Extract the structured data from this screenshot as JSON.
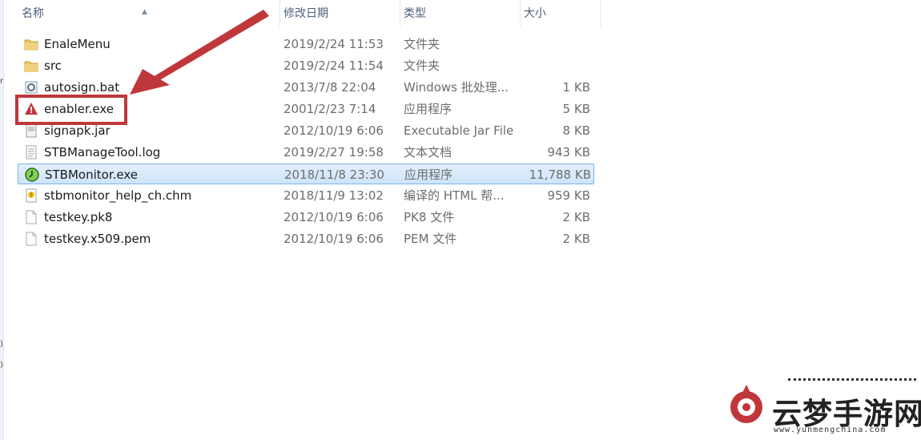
{
  "columns": {
    "name": "名称",
    "date": "修改日期",
    "type": "类型",
    "size": "大小"
  },
  "files": [
    {
      "name": "EnaleMenu",
      "date": "2019/2/24 11:53",
      "type": "文件夹",
      "size": "",
      "icon": "folder-icon"
    },
    {
      "name": "src",
      "date": "2019/2/24 11:54",
      "type": "文件夹",
      "size": "",
      "icon": "folder-icon"
    },
    {
      "name": "autosign.bat",
      "date": "2013/7/8 22:04",
      "type": "Windows 批处理...",
      "size": "1 KB",
      "icon": "batch-file-icon"
    },
    {
      "name": "enabler.exe",
      "date": "2001/2/23 7:14",
      "type": "应用程序",
      "size": "5 KB",
      "icon": "warning-exe-icon"
    },
    {
      "name": "signapk.jar",
      "date": "2012/10/19 6:06",
      "type": "Executable Jar File",
      "size": "8 KB",
      "icon": "jar-file-icon"
    },
    {
      "name": "STBManageTool.log",
      "date": "2019/2/27 19:58",
      "type": "文本文档",
      "size": "943 KB",
      "icon": "text-file-icon"
    },
    {
      "name": "STBMonitor.exe",
      "date": "2018/11/8 23:30",
      "type": "应用程序",
      "size": "11,788 KB",
      "icon": "monitor-exe-icon",
      "selected": true
    },
    {
      "name": "stbmonitor_help_ch.chm",
      "date": "2018/11/9 13:02",
      "type": "编译的 HTML 帮...",
      "size": "959 KB",
      "icon": "help-file-icon"
    },
    {
      "name": "testkey.pk8",
      "date": "2012/10/19 6:06",
      "type": "PK8 文件",
      "size": "2 KB",
      "icon": "blank-file-icon"
    },
    {
      "name": "testkey.x509.pem",
      "date": "2012/10/19 6:06",
      "type": "PEM 文件",
      "size": "2 KB",
      "icon": "blank-file-icon"
    }
  ],
  "annotation": {
    "color": "#c0373b",
    "target": "enabler.exe"
  },
  "watermark": {
    "title": "云梦手游网",
    "url": "www.yunmengchina.com"
  },
  "colors": {
    "selection": "#cfe4fa",
    "header_text": "#4c607a",
    "highlight": "#c0373b"
  }
}
